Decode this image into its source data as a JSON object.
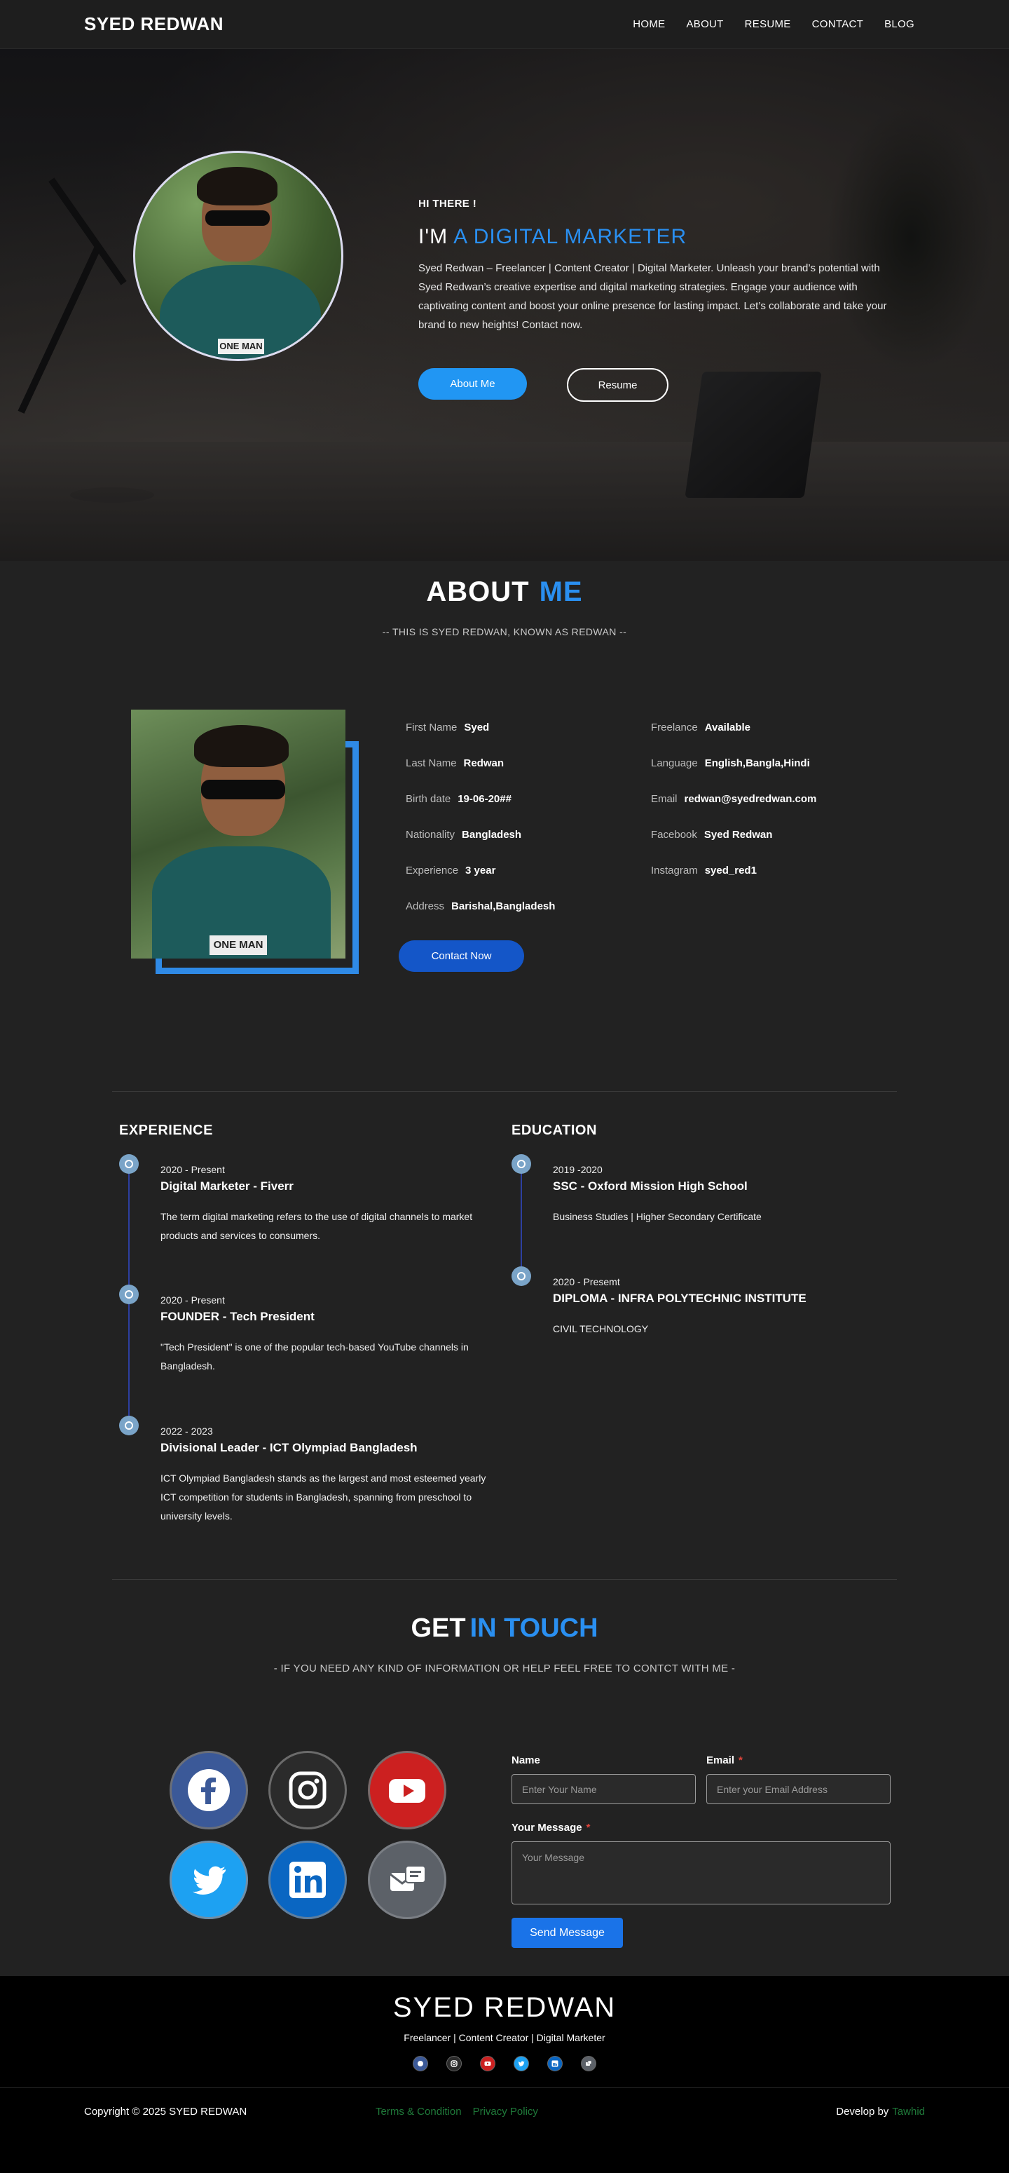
{
  "nav": {
    "brand": "SYED REDWAN",
    "links": [
      "HOME",
      "ABOUT",
      "RESUME",
      "CONTACT",
      "BLOG"
    ]
  },
  "hero": {
    "greeting": "HI THERE !",
    "im": "I'M",
    "role": "A  DIGITAL  MARKETER",
    "bio": "Syed Redwan – Freelancer | Content Creator | Digital Marketer. Unleash your brand’s potential with Syed Redwan’s creative expertise and digital marketing strategies. Engage your audience with captivating content and boost your online presence for lasting impact. Let’s collaborate and take your brand to new heights! Contact now.",
    "photo_tag": "ONE MAN",
    "btn_about": "About Me",
    "btn_resume": "Resume"
  },
  "about": {
    "title_a": "ABOUT",
    "title_b": "ME",
    "subtitle": "-- THIS IS SYED REDWAN, KNOWN AS REDWAN --",
    "photo_tag": "ONE MAN",
    "left": [
      {
        "k": "First Name",
        "v": "Syed"
      },
      {
        "k": "Last Name",
        "v": "Redwan"
      },
      {
        "k": "Birth date",
        "v": "19-06-20##"
      },
      {
        "k": "Nationality",
        "v": "Bangladesh"
      },
      {
        "k": "Experience",
        "v": "3 year"
      },
      {
        "k": "Address",
        "v": "Barishal,Bangladesh"
      }
    ],
    "right": [
      {
        "k": "Freelance",
        "v": "Available"
      },
      {
        "k": "Language",
        "v": "English,Bangla,Hindi"
      },
      {
        "k": "Email",
        "v": "redwan@syedredwan.com"
      },
      {
        "k": "Facebook",
        "v": "Syed Redwan"
      },
      {
        "k": "Instagram",
        "v": "syed_red1"
      }
    ],
    "btn_contact": "Contact Now"
  },
  "experience": {
    "title": "EXPERIENCE",
    "items": [
      {
        "date": "2020 - Present",
        "head": "Digital Marketer - Fiverr",
        "desc": "The term digital marketing refers to the use of digital channels to market products and services to consumers."
      },
      {
        "date": "2020 - Present",
        "head": "FOUNDER - Tech President",
        "desc": "\"Tech President\" is one of the popular tech-based YouTube channels in Bangladesh."
      },
      {
        "date": "2022 - 2023",
        "head": "Divisional Leader - ICT Olympiad Bangladesh",
        "desc": "ICT Olympiad Bangladesh stands as the largest and most esteemed yearly ICT competition for students in Bangladesh, spanning from preschool to university levels."
      }
    ]
  },
  "education": {
    "title": "EDUCATION",
    "items": [
      {
        "date": "2019 -2020",
        "head": "SSC - Oxford Mission High School",
        "desc": "Business Studies | Higher Secondary Certificate"
      },
      {
        "date": "2020 - Presemt",
        "head": "DIPLOMA - INFRA POLYTECHNIC INSTITUTE",
        "desc": "CIVIL TECHNOLOGY"
      }
    ]
  },
  "contact": {
    "title_a": "GET",
    "title_b": "IN TOUCH",
    "subtitle": "- IF YOU NEED ANY KIND OF INFORMATION OR HELP FEEL FREE TO CONTCT WITH ME -",
    "name_label": "Name",
    "name_placeholder": "Enter Your Name",
    "email_label": "Email",
    "email_placeholder": "Enter your Email Address",
    "message_label": "Your Message",
    "message_placeholder": "Your Message",
    "required_mark": "*",
    "btn_send": "Send Message",
    "colors": {
      "facebook": "#3b5998",
      "instagram": "#2b2b2b",
      "youtube": "#cc2020",
      "twitter": "#1da1f2",
      "linkedin": "#0a66c2",
      "message": "#5c6168"
    }
  },
  "footer": {
    "brand": "SYED REDWAN",
    "tagline": "Freelancer | Content Creator | Digital Marketer",
    "copyright": "Copyright © 2025 SYED REDWAN",
    "link_terms": "Terms & Condition",
    "link_privacy": "Privacy Policy",
    "develop_by": "Develop by",
    "developer": "Tawhid"
  }
}
